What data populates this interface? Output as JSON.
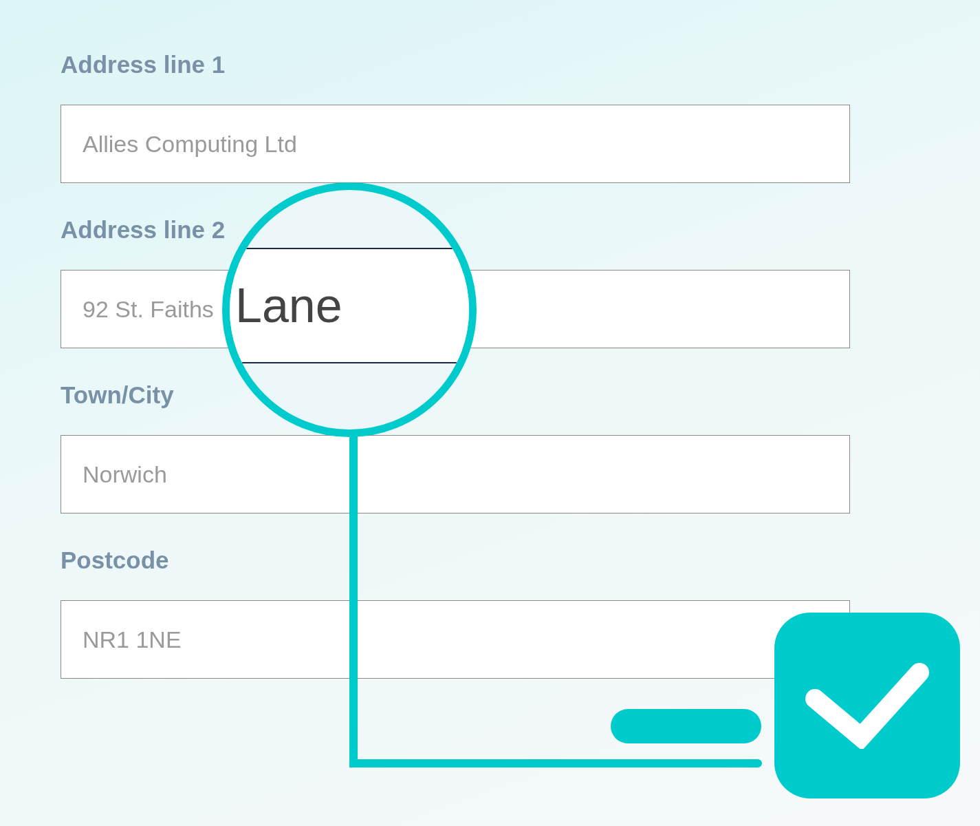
{
  "form": {
    "fields": [
      {
        "label": "Address line 1",
        "value": "Allies Computing Ltd"
      },
      {
        "label": "Address line 2",
        "value": "92 St. Faiths"
      },
      {
        "label": "Town/City",
        "value": "Norwich"
      },
      {
        "label": "Postcode",
        "value": "NR1 1NE"
      }
    ]
  },
  "magnifier": {
    "text": "Lane"
  },
  "checkbox": {
    "checked": true
  }
}
